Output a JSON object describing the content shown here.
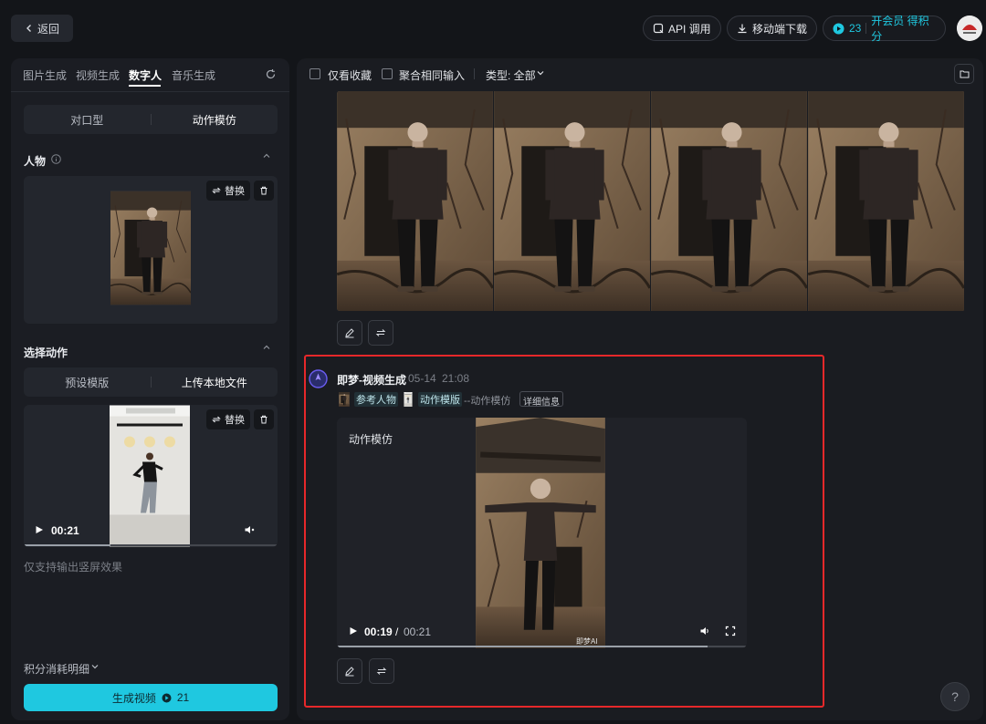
{
  "topbar": {
    "back_label": "返回",
    "api_label": "API 调用",
    "mobile_label": "移动端下载",
    "credits_value": "23",
    "member_label": "开会员 得积分"
  },
  "left": {
    "tabs": [
      "图片生成",
      "视频生成",
      "数字人",
      "音乐生成"
    ],
    "active_tab": "数字人",
    "mode_options": [
      "对口型",
      "动作模仿"
    ],
    "active_mode": "动作模仿",
    "person_title": "人物",
    "replace_label": "替换",
    "action_title": "选择动作",
    "action_options": [
      "预设模版",
      "上传本地文件"
    ],
    "video_time": "00:21",
    "hint": "仅支持输出竖屏效果",
    "credits_detail": "积分消耗明细",
    "generate_label": "生成视频",
    "generate_cost": "21"
  },
  "right": {
    "filter_favorites": "仅看收藏",
    "filter_merge": "聚合相同输入",
    "type_label": "类型: 全部",
    "task": {
      "source": "即梦-视频生成",
      "date": "05-14",
      "time": "21:08",
      "ref_person": "参考人物",
      "action_template": "动作模版",
      "suffix": "--动作模仿",
      "detail": "详细信息",
      "card_title": "动作模仿",
      "current_time": "00:19",
      "separator": "/",
      "duration": "00:21",
      "watermark": "即梦AI"
    },
    "help": "?"
  },
  "colors": {
    "accent": "#1fc8e0",
    "highlight": "#e6282a",
    "panel": "#1b1d23",
    "bg": "#131519"
  }
}
